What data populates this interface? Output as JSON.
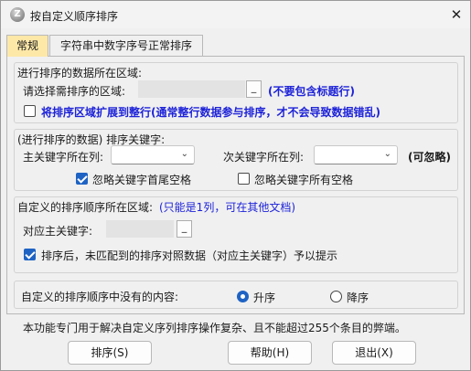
{
  "window": {
    "title": "按自定义顺序排序",
    "icon_letter": "Z",
    "close_glyph": "✕"
  },
  "tabs": [
    {
      "label": "常规",
      "active": true
    },
    {
      "label": "字符串中数字序号正常排序",
      "active": false
    }
  ],
  "data_area": {
    "group_title": "进行排序的数据所在区域:",
    "prompt": "请选择需排序的区域:",
    "range_value": "",
    "pick_label": "_",
    "hint": "(不要包含标题行)",
    "expand_checkbox": {
      "label": "将排序区域扩展到整行(通常整行数据参与排序，才不会导致数据错乱)",
      "checked": false
    }
  },
  "sort_keys": {
    "group_title": "(进行排序的数据) 排序关键字:",
    "primary_label": "主关键字所在列:",
    "primary_value": "",
    "secondary_label": "次关键字所在列:",
    "secondary_value": "",
    "secondary_hint": "(可忽略)",
    "ignore_edge_spaces": {
      "label": "忽略关键字首尾空格",
      "checked": true
    },
    "ignore_all_spaces": {
      "label": "忽略关键字所有空格",
      "checked": false
    }
  },
  "custom_order": {
    "group_title": "自定义的排序顺序所在区域:",
    "group_hint": "(只能是1列，可在其他文档)",
    "key_label": "对应主关键字:",
    "key_value": "",
    "pick_label": "_",
    "notify_checkbox": {
      "label": "排序后，未匹配到的排序对照数据（对应主关键字）予以提示",
      "checked": true
    }
  },
  "missing": {
    "label": "自定义的排序顺序中没有的内容:",
    "options": [
      {
        "label": "升序",
        "checked": true
      },
      {
        "label": "降序",
        "checked": false
      }
    ]
  },
  "footer_note": "本功能专门用于解决自定义序列排序操作复杂、且不能超过255个条目的弊端。",
  "buttons": {
    "sort": "排序(S)",
    "help": "帮助(H)",
    "exit": "退出(X)"
  },
  "colors": {
    "active_tab": "#fde8a8",
    "hint_blue": "#1d22d8",
    "accent": "#1e63c4"
  }
}
